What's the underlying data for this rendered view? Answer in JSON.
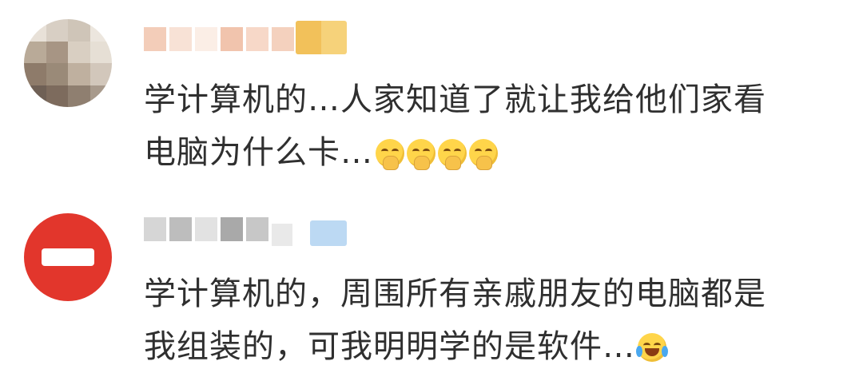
{
  "comments": [
    {
      "text_line1": "学计算机的…人家知道了就让我给他们家看",
      "text_line2": "电脑为什么卡…",
      "emoji_icon": "grin-hand-over-mouth-icon",
      "emoji_count": 4
    },
    {
      "text_line1": "学计算机的，周围所有亲戚朋友的电脑都是",
      "text_line2": "我组装的，可我明明学的是软件…",
      "emoji_icon": "laughing-tears-icon",
      "emoji_count": 1
    }
  ],
  "colors": {
    "text": "#2f2f2f",
    "avatar2_red": "#e2362c",
    "badge1_gold": "#f2c15a",
    "badge2_blue": "#bcd9f3"
  }
}
